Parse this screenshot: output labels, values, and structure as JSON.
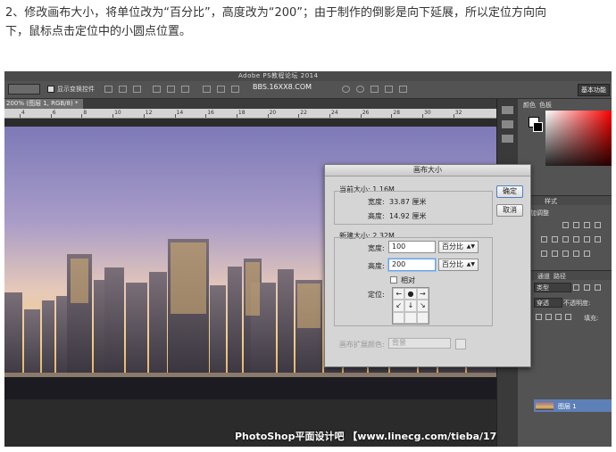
{
  "instruction": {
    "line1": "2、修改画布大小，将单位改为“百分比”，高度改为“200”；由于制作的倒影是向下延展，所以定位方向向",
    "line2": "下，鼠标点击定位中的小圆点位置。"
  },
  "app": {
    "title_watermark": "Adobe PS教程论坛 2014",
    "site_watermark": "BBS.16XX8.COM",
    "tool_preset": "",
    "show_transform_label": "显示变换控件",
    "workspace": "基本功能",
    "doc_tab": "200% (图层 1, RGB/8) *",
    "ruler_ticks": [
      "4",
      "6",
      "8",
      "10",
      "12",
      "14",
      "16",
      "18",
      "20",
      "22",
      "24",
      "26",
      "28",
      "30",
      "32"
    ],
    "banner": "PhotoShop平面设计吧 【www.linecg.com/tieba/1783】"
  },
  "panels": {
    "color_tab": "颜色",
    "swatches_tab": "色板",
    "styles_tab": "样式",
    "adjust_label": "加调整",
    "channels_tab": "通道",
    "paths_tab": "路径",
    "layer_kind": "类型",
    "blend_mode": "穿透",
    "opacity_label": "不透明度:",
    "fill_label": "填充:",
    "layer_name": "图层 1"
  },
  "dialog": {
    "title": "画布大小",
    "current_size_label": "当前大小: 1.16M",
    "current_width_label": "宽度:",
    "current_width_value": "33.87 厘米",
    "current_height_label": "高度:",
    "current_height_value": "14.92 厘米",
    "new_size_label": "新建大小: 2.32M",
    "width_label": "宽度:",
    "width_value": "100",
    "width_unit": "百分比",
    "height_label": "高度:",
    "height_value": "200",
    "height_unit": "百分比",
    "relative_label": "相对",
    "anchor_label": "定位:",
    "anchor_cells": [
      "←",
      "●",
      "→",
      "↙",
      "↓",
      "↘",
      "",
      "",
      ""
    ],
    "ext_color_label": "画布扩展颜色:",
    "ext_color_value": "背景",
    "ok_label": "确定",
    "cancel_label": "取消"
  }
}
